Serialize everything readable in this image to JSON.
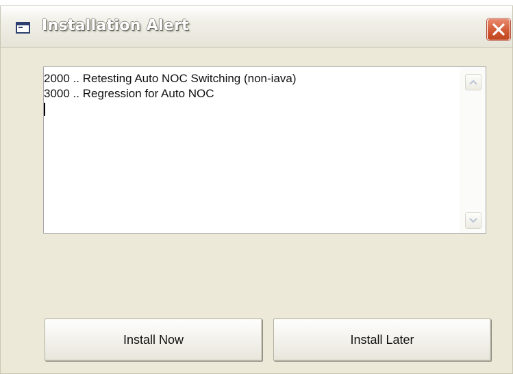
{
  "window": {
    "title": "Installation Alert",
    "close_icon": "close-icon"
  },
  "message_box": {
    "lines": [
      "2000 .. Retesting Auto NOC Switching (non-iava)",
      "3000 .. Regression for Auto NOC"
    ]
  },
  "buttons": {
    "install_now": "Install Now",
    "install_later": "Install Later"
  },
  "colors": {
    "dialog_background": "#ece9d8",
    "close_button": "#d35b36"
  }
}
